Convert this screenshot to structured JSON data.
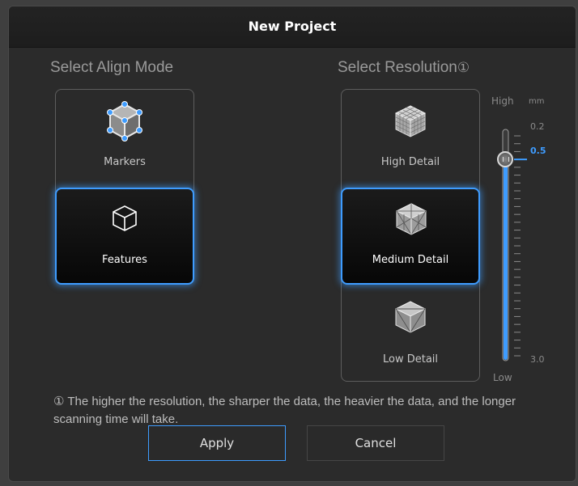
{
  "dialog": {
    "title": "New Project"
  },
  "align_mode": {
    "heading": "Select Align Mode",
    "options": [
      {
        "label": "Markers",
        "icon": "markers-cube-icon",
        "selected": false
      },
      {
        "label": "Features",
        "icon": "cube-outline-icon",
        "selected": true
      }
    ]
  },
  "resolution": {
    "heading": "Select Resolution",
    "heading_marker": "①",
    "options": [
      {
        "label": "High Detail",
        "icon": "high-detail-cube-icon",
        "selected": false
      },
      {
        "label": "Medium Detail",
        "icon": "medium-detail-cube-icon",
        "selected": true
      },
      {
        "label": "Low Detail",
        "icon": "low-detail-cube-icon",
        "selected": false
      }
    ],
    "slider": {
      "top_label": "High",
      "bottom_label": "Low",
      "unit": "mm",
      "min_label": "0.2",
      "max_label": "3.0",
      "current_value": "0.5",
      "value": 0.5,
      "min": 0.2,
      "max": 3.0
    }
  },
  "note": "① The higher the resolution, the sharper the data, the heavier the data, and the longer scanning time will take.",
  "buttons": {
    "apply": "Apply",
    "cancel": "Cancel"
  },
  "colors": {
    "accent": "#3e9cff",
    "background": "#2b2b2b",
    "title_bar": "#1f1f1f"
  }
}
